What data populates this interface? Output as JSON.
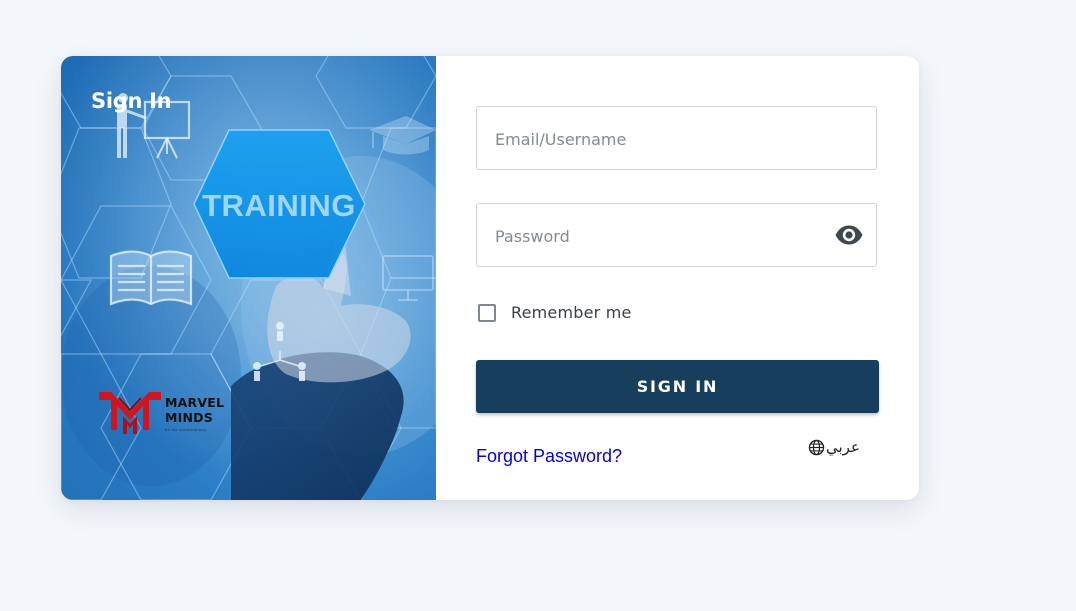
{
  "hero": {
    "title": "Sign In",
    "training_label": "TRAINING",
    "brand_line1": "MARVEL",
    "brand_line2": "MINDS",
    "brand_tagline": "be the extraordinary"
  },
  "form": {
    "email_placeholder": "Email/Username",
    "email_value": "",
    "password_placeholder": "Password",
    "password_value": "",
    "remember_label": "Remember me",
    "remember_checked": false,
    "signin_label": "SIGN IN",
    "forgot_label": "Forgot Password?",
    "language_label": "عربي"
  },
  "icons": {
    "show_password": "eye-icon",
    "language": "globe-icon"
  },
  "colors": {
    "page_bg": "#f3f6fa",
    "primary_button": "#183e5d",
    "link": "#0000ee",
    "hero_blue": "#2a7cc4",
    "brand_red": "#d4141c"
  }
}
